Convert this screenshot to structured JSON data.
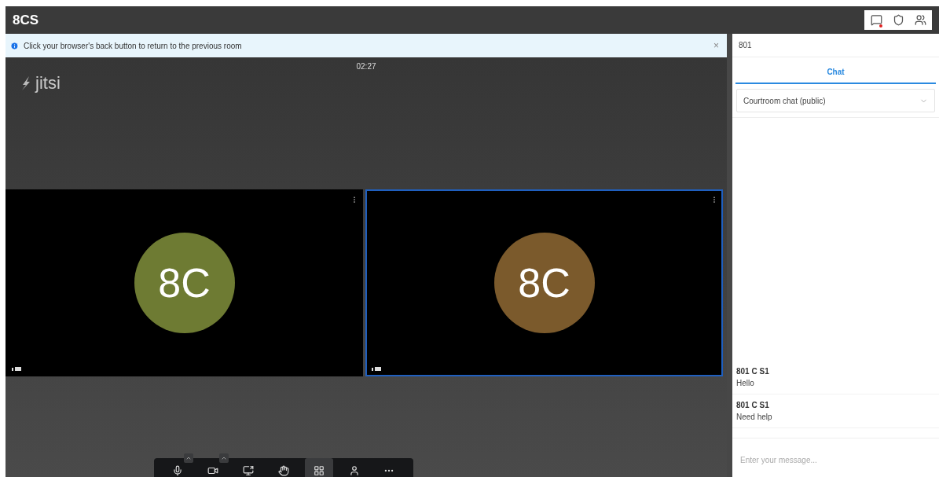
{
  "header": {
    "title": "8CS",
    "icons": [
      {
        "kind": "chat",
        "badge": true
      },
      {
        "kind": "shield",
        "badge": false
      },
      {
        "kind": "people",
        "badge": false
      }
    ]
  },
  "notice": {
    "text": "Click your browser's back button to return to the previous room",
    "close": "×"
  },
  "conference": {
    "timer": "02:27",
    "logo": "jitsi",
    "tiles": [
      {
        "initials": "8C",
        "color": "#6e7b33",
        "selected": false
      },
      {
        "initials": "8C",
        "color": "#7b5a2c",
        "selected": true
      }
    ],
    "toolbar": [
      {
        "kind": "mic",
        "selected": false,
        "caret": true
      },
      {
        "kind": "camera",
        "selected": false,
        "caret": true
      },
      {
        "kind": "screen",
        "selected": false,
        "caret": false
      },
      {
        "kind": "hand",
        "selected": false,
        "caret": false
      },
      {
        "kind": "tiles",
        "selected": true,
        "caret": false
      },
      {
        "kind": "person",
        "selected": false,
        "caret": false
      },
      {
        "kind": "more",
        "selected": false,
        "caret": false
      }
    ]
  },
  "chat": {
    "room": "801",
    "tabs": [
      {
        "label": "Chat",
        "selected": true
      }
    ],
    "channel": "Courtroom chat (public)",
    "messages": [
      {
        "sender": "801 C S1",
        "text": "Hello"
      },
      {
        "sender": "801 C S1",
        "text": "Need help"
      }
    ],
    "placeholder": "Enter your message..."
  }
}
